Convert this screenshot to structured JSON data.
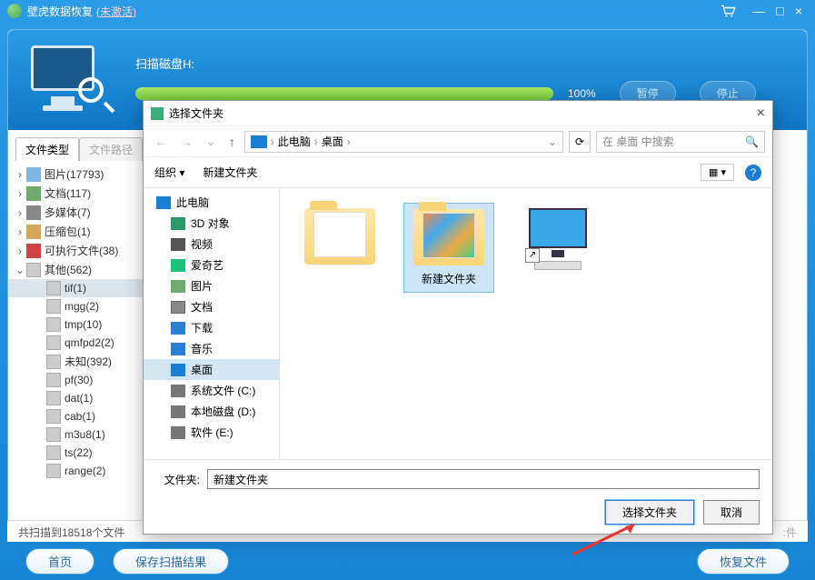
{
  "app": {
    "title": "壁虎数据恢复",
    "unactivated": "(未激活)"
  },
  "window_controls": {
    "min": "—",
    "max": "□",
    "close": "×"
  },
  "progress": {
    "label": "扫描磁盘H:",
    "percent": "100%",
    "pause": "暂停",
    "stop": "停止"
  },
  "tabs": {
    "type": "文件类型",
    "path": "文件路径"
  },
  "tree": [
    {
      "label": "图片(17793)",
      "icon": "pic",
      "expandable": true
    },
    {
      "label": "文档(117)",
      "icon": "doc",
      "expandable": true
    },
    {
      "label": "多媒体(7)",
      "icon": "media",
      "expandable": true
    },
    {
      "label": "压缩包(1)",
      "icon": "zip",
      "expandable": true
    },
    {
      "label": "可执行文件(38)",
      "icon": "exe",
      "expandable": true
    },
    {
      "label": "其他(562)",
      "icon": "other",
      "expanded": true,
      "children": [
        {
          "label": "tif(1)",
          "selected": true
        },
        {
          "label": "mgg(2)"
        },
        {
          "label": "tmp(10)"
        },
        {
          "label": "qmfpd2(2)"
        },
        {
          "label": "未知(392)"
        },
        {
          "label": "pf(30)"
        },
        {
          "label": "dat(1)"
        },
        {
          "label": "cab(1)"
        },
        {
          "label": "m3u8(1)"
        },
        {
          "label": "ts(22)"
        },
        {
          "label": "range(2)"
        }
      ]
    }
  ],
  "status": "共扫描到18518个文件",
  "buttons": {
    "home": "首页",
    "save_scan": "保存扫描结果",
    "recover": "恢复文件"
  },
  "dialog": {
    "title": "选择文件夹",
    "breadcrumb": {
      "root": "此电脑",
      "folder": "桌面"
    },
    "search_placeholder": "在 桌面 中搜索",
    "organize": "组织",
    "new_folder": "新建文件夹",
    "tree": {
      "this_pc": "此电脑",
      "items": [
        {
          "label": "3D 对象",
          "icon": "3d"
        },
        {
          "label": "视频",
          "icon": "vid"
        },
        {
          "label": "爱奇艺",
          "icon": "iqy"
        },
        {
          "label": "图片",
          "icon": "pic2"
        },
        {
          "label": "文档",
          "icon": "doc2"
        },
        {
          "label": "下载",
          "icon": "dl"
        },
        {
          "label": "音乐",
          "icon": "music"
        },
        {
          "label": "桌面",
          "icon": "desk",
          "selected": true
        },
        {
          "label": "系统文件 (C:)",
          "icon": "drive"
        },
        {
          "label": "本地磁盘 (D:)",
          "icon": "drive"
        },
        {
          "label": "软件 (E:)",
          "icon": "drive"
        }
      ]
    },
    "files": [
      {
        "label": "",
        "type": "folder-docs"
      },
      {
        "label": "新建文件夹",
        "type": "folder-color",
        "selected": true
      },
      {
        "label": "",
        "type": "pc-shortcut"
      }
    ],
    "filename_label": "文件夹:",
    "filename_value": "新建文件夹",
    "select_btn": "选择文件夹",
    "cancel_btn": "取消"
  }
}
